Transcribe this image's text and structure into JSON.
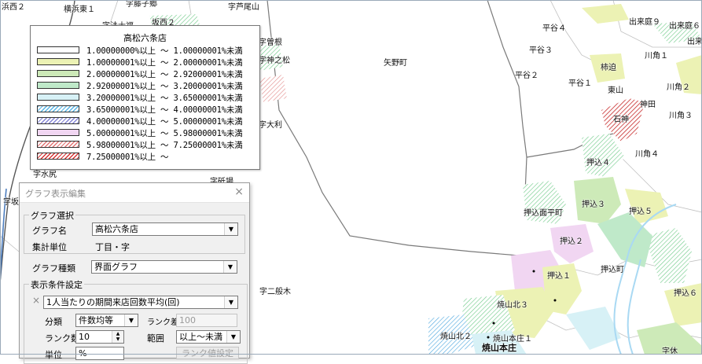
{
  "map": {
    "labels": [
      {
        "text": "浜西２"
      },
      {
        "text": "横浜東１"
      },
      {
        "text": "字藤子郷"
      },
      {
        "text": "字芦尾山"
      },
      {
        "text": "字法士福"
      },
      {
        "text": "坂西２"
      },
      {
        "text": "字曽根"
      },
      {
        "text": "字神之松"
      },
      {
        "text": "矢野町"
      },
      {
        "text": "字大利"
      },
      {
        "text": "字水尻"
      },
      {
        "text": "字坂"
      },
      {
        "text": "字砥場"
      },
      {
        "text": "字二般木"
      },
      {
        "text": "平谷４"
      },
      {
        "text": "平谷３"
      },
      {
        "text": "平谷２"
      },
      {
        "text": "平谷１"
      },
      {
        "text": "出来庭９"
      },
      {
        "text": "出来庭６"
      },
      {
        "text": "出来"
      },
      {
        "text": "川角１"
      },
      {
        "text": "川角２"
      },
      {
        "text": "川角３"
      },
      {
        "text": "川角４"
      },
      {
        "text": "柿迫"
      },
      {
        "text": "東山"
      },
      {
        "text": "神田"
      },
      {
        "text": "石神"
      },
      {
        "text": "押込４"
      },
      {
        "text": "押込面平町"
      },
      {
        "text": "押込３"
      },
      {
        "text": "押込５"
      },
      {
        "text": "押込２"
      },
      {
        "text": "押込１"
      },
      {
        "text": "押込町"
      },
      {
        "text": "押込６"
      },
      {
        "text": "焼山北３"
      },
      {
        "text": "焼山北２"
      },
      {
        "text": "焼山本庄１"
      },
      {
        "text": "焼山本庄"
      },
      {
        "text": "字休"
      }
    ]
  },
  "legend": {
    "title": "高松六条店",
    "items": [
      {
        "text": "1.00000000%以上 ～ 1.00000001%未満",
        "color": "#ffffff",
        "pattern": "none"
      },
      {
        "text": "1.00000001%以上 ～ 2.00000001%未満",
        "color": "#ecf2b4",
        "pattern": "solid"
      },
      {
        "text": "2.00000001%以上 ～ 2.92000001%未満",
        "color": "#cdeab8",
        "pattern": "solid"
      },
      {
        "text": "2.92000001%以上 ～ 3.20000001%未満",
        "color": "#bfe9c9",
        "pattern": "solid"
      },
      {
        "text": "3.20000001%以上 ～ 3.65000001%未満",
        "color": "#d7f1f6",
        "pattern": "solid"
      },
      {
        "text": "3.65000001%以上 ～ 4.00000001%未満",
        "color": "#58b5e6",
        "pattern": "hatch"
      },
      {
        "text": "4.00000001%以上 ～ 5.00000001%未満",
        "color": "#8585d6",
        "pattern": "hatch"
      },
      {
        "text": "5.00000001%以上 ～ 5.98000001%未満",
        "color": "#f1d6f2",
        "pattern": "solid"
      },
      {
        "text": "5.98000001%以上 ～ 7.25000001%未満",
        "color": "#e27474",
        "pattern": "hatch"
      },
      {
        "text": "7.25000001%以上 ～",
        "color": "#d53333",
        "pattern": "hatch"
      }
    ]
  },
  "dialog": {
    "title": "グラフ表示編集",
    "close_icon": "×",
    "graph_select": {
      "caption": "グラフ選択",
      "name_label": "グラフ名",
      "name_value": "高松六条店",
      "unit_label": "集計単位",
      "unit_value": "丁目・字"
    },
    "graph_type_label": "グラフ種類",
    "graph_type_value": "界面グラフ",
    "display_condition": {
      "caption": "表示条件設定",
      "checkbox_mark": "×",
      "metric_value": "1人当たりの期間来店回数平均(回)",
      "category_label": "分類",
      "category_value": "件数均等",
      "rank_diff_label": "ランク差",
      "rank_diff_value": "100",
      "rank_count_label": "ランク数",
      "rank_count_value": "10",
      "range_label": "範囲",
      "range_value": "以上～未満",
      "unit_label": "単位",
      "unit_value": "%",
      "rank_value_button": "ランク値設定"
    }
  }
}
